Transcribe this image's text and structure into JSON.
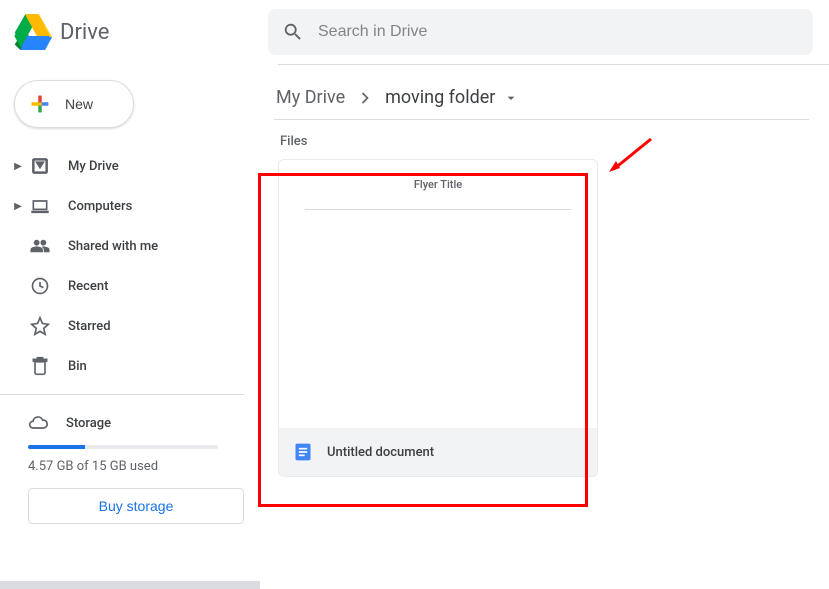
{
  "header": {
    "app_name": "Drive",
    "search_placeholder": "Search in Drive"
  },
  "sidebar": {
    "new_label": "New",
    "items": [
      {
        "label": "My Drive",
        "expandable": true
      },
      {
        "label": "Computers",
        "expandable": true
      },
      {
        "label": "Shared with me",
        "expandable": false
      },
      {
        "label": "Recent",
        "expandable": false
      },
      {
        "label": "Starred",
        "expandable": false
      },
      {
        "label": "Bin",
        "expandable": false
      }
    ],
    "storage_label": "Storage",
    "storage_usage": "4.57 GB of 15 GB used",
    "storage_percent": 30,
    "buy_label": "Buy storage"
  },
  "breadcrumb": {
    "root": "My Drive",
    "current": "moving folder"
  },
  "main": {
    "section_label": "Files",
    "file": {
      "name": "Untitled document",
      "preview_title": "Flyer Title"
    }
  }
}
